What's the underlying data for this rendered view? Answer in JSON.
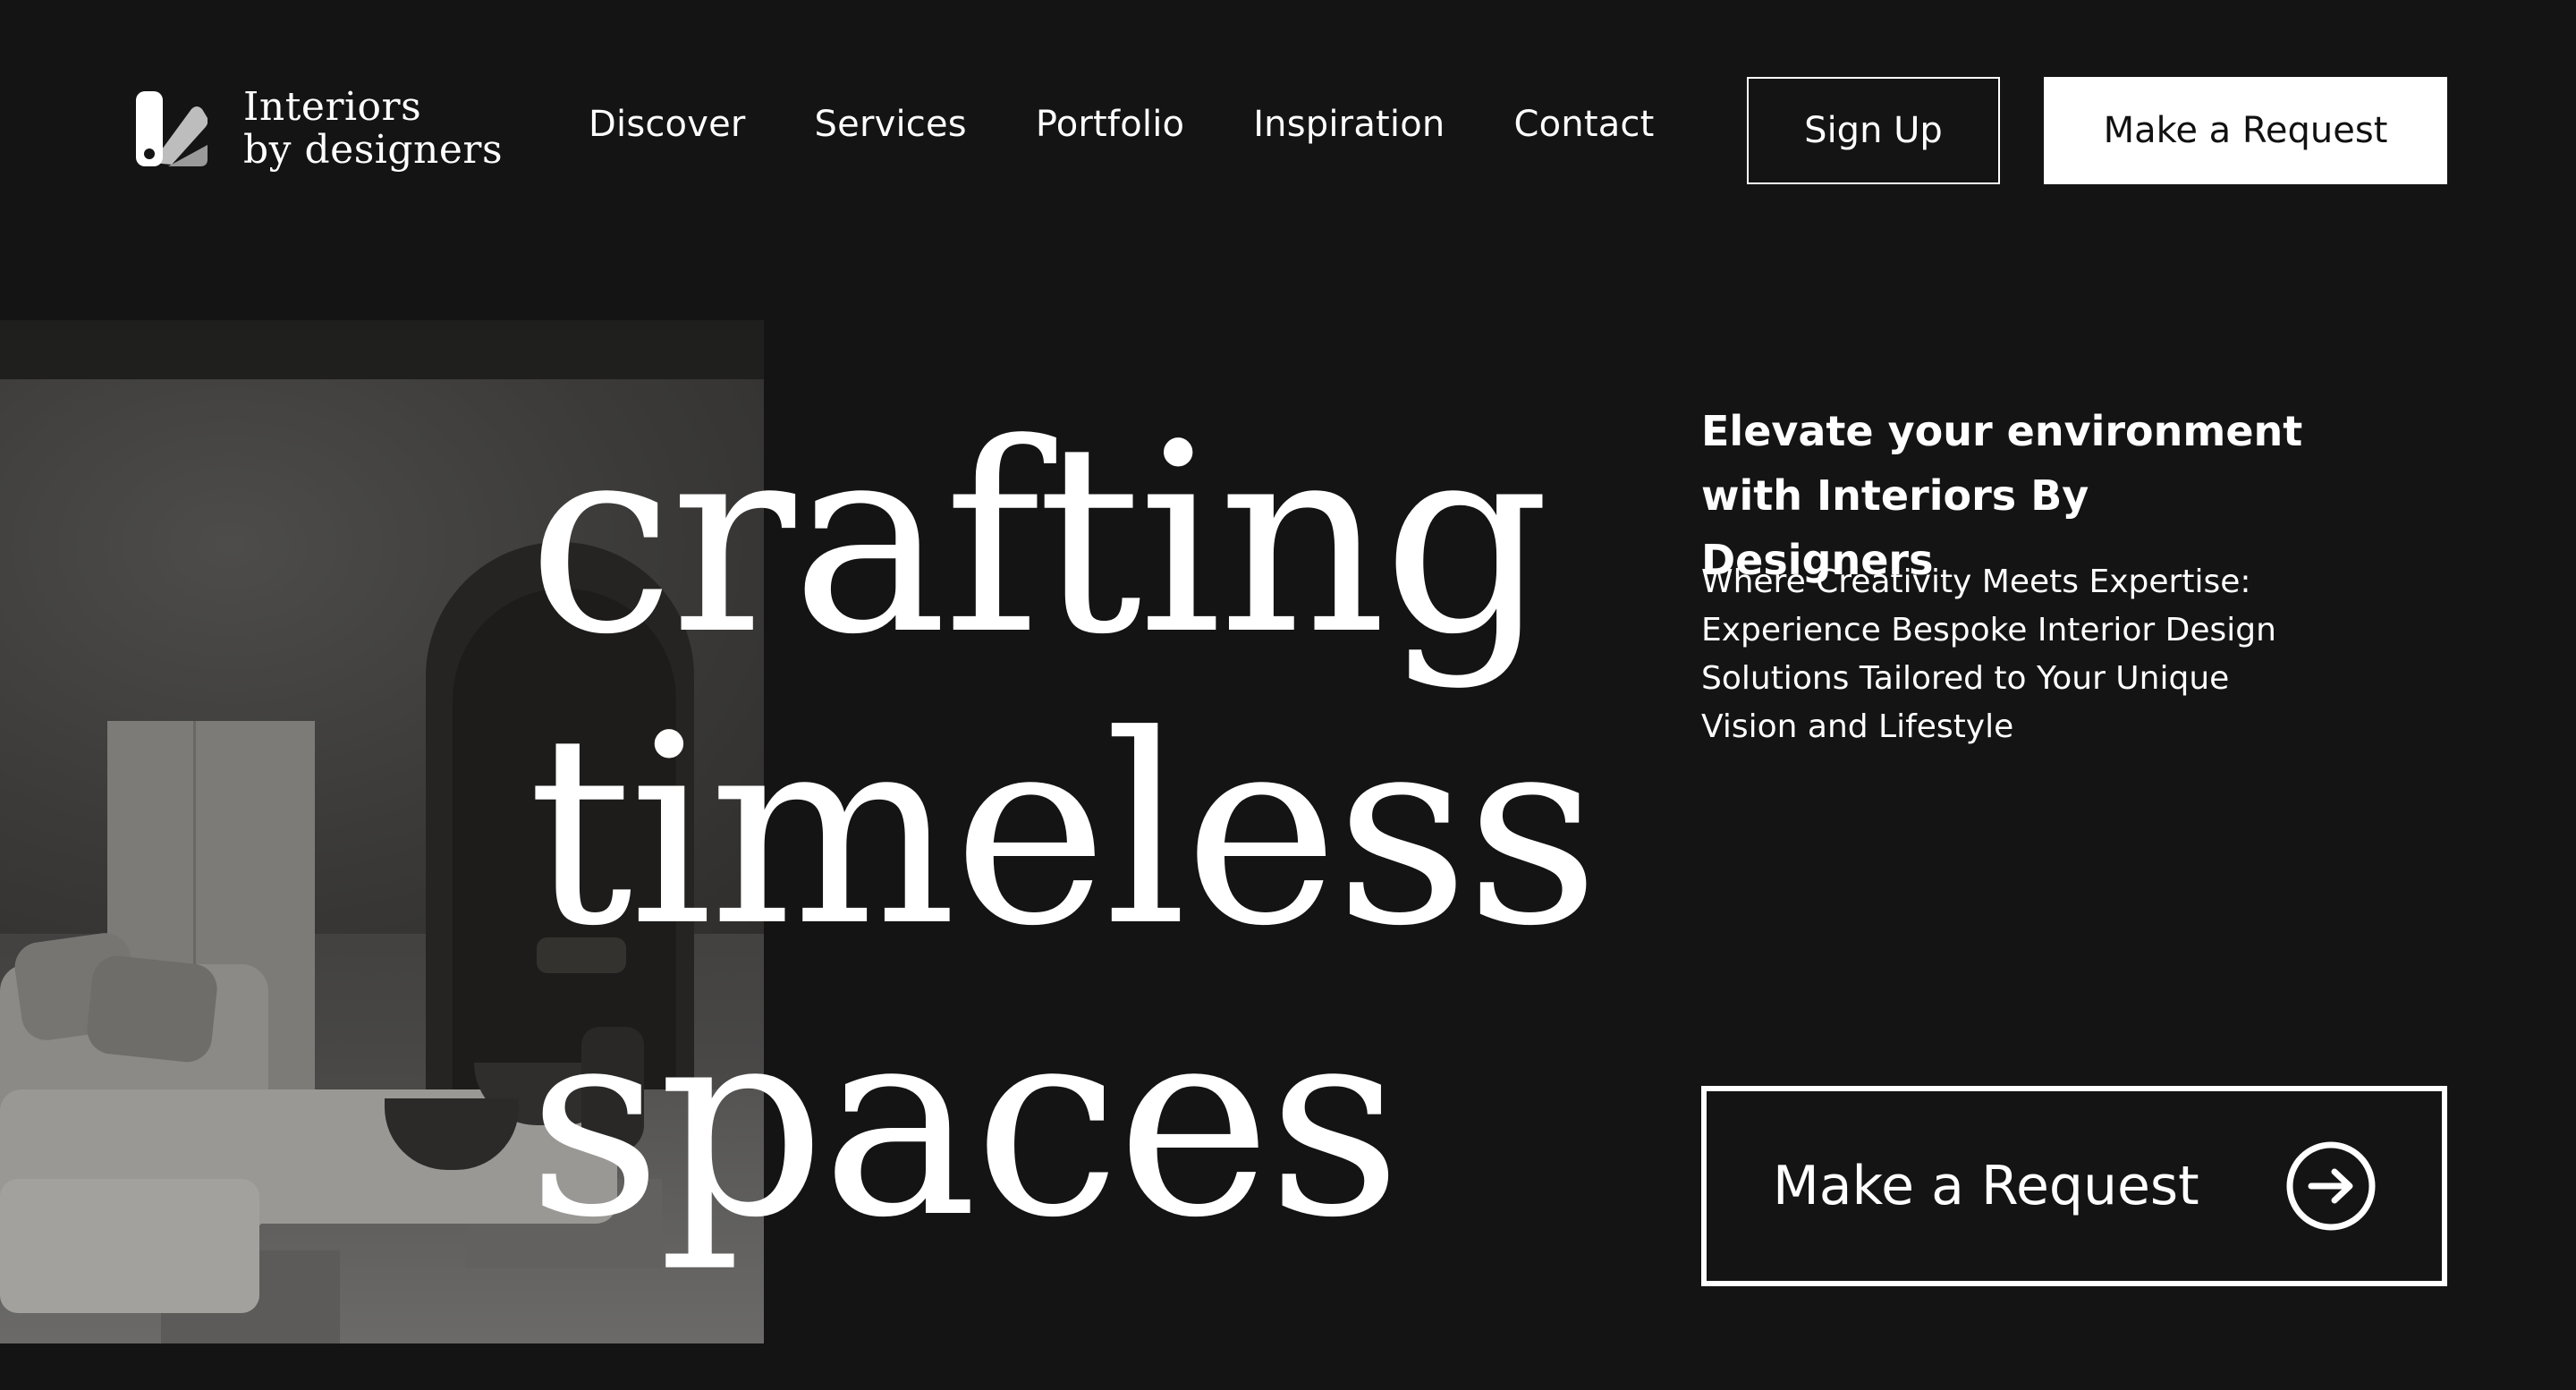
{
  "brand": {
    "line1": "Interiors",
    "line2": "by designers",
    "logo_icon": "swatch-logo-icon"
  },
  "nav": {
    "items": [
      {
        "label": "Discover"
      },
      {
        "label": "Services"
      },
      {
        "label": "Portfolio"
      },
      {
        "label": "Inspiration"
      },
      {
        "label": "Contact"
      }
    ]
  },
  "header_actions": {
    "signup_label": "Sign Up",
    "request_label": "Make a Request"
  },
  "hero": {
    "headline": [
      "crafting",
      "timeless",
      "spaces"
    ],
    "image_alt": "minimal grey living room with arched doorway",
    "tagline": [
      "Elevate your environment",
      "with Interiors By Designers"
    ],
    "description": [
      "Where Creativity Meets Expertise:",
      "Experience Bespoke Interior Design",
      "Solutions Tailored to Your Unique",
      "Vision and Lifestyle"
    ],
    "cta_label": "Make a Request",
    "cta_icon": "arrow-right-circle-icon"
  },
  "colors": {
    "background": "#141414",
    "text": "#ffffff",
    "button_fill": "#ffffff",
    "button_text": "#111111"
  }
}
